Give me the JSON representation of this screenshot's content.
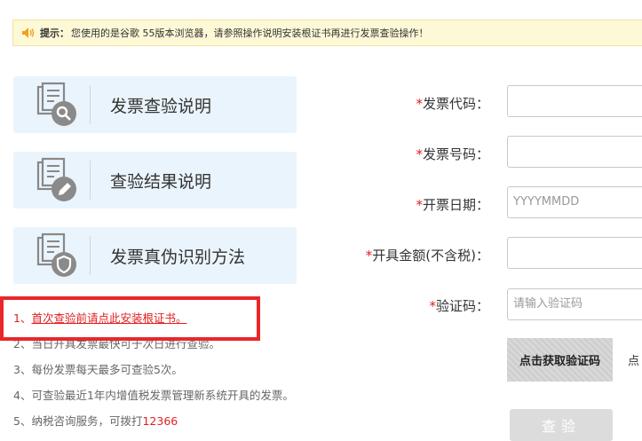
{
  "notice": {
    "label": "提示：",
    "text": "您使用的是谷歌 55版本浏览器，请参照操作说明安装根证书再进行发票查验操作！"
  },
  "cards": [
    {
      "label": "发票查验说明",
      "icon": "document-search-icon"
    },
    {
      "label": "查验结果说明",
      "icon": "document-edit-icon"
    },
    {
      "label": "发票真伪识别方法",
      "icon": "document-shield-icon"
    }
  ],
  "notes": {
    "item1_prefix": "1、",
    "item1_link": "首次查验前请点此安装根证书。",
    "item2": "2、当日开具发票最快可于次日进行查验。",
    "item3": "3、每份发票每天最多可查验5次。",
    "item4": "4、可查验最近1年内增值税发票管理新系统开具的发票。",
    "item5_prefix": "5、纳税咨询服务，可拨打",
    "item5_phone": "12366"
  },
  "form": {
    "required_mark": "*",
    "invoice_code_label": "发票代码：",
    "invoice_number_label": "发票号码：",
    "issue_date_label": "开票日期：",
    "issue_date_placeholder": "YYYYMMDD",
    "amount_label": "开具金额(不含税)：",
    "captcha_label": "验证码：",
    "captcha_placeholder": "请输入验证码",
    "captcha_image_text": "点击获取验证码",
    "captcha_hint": "点",
    "submit_label": "查验"
  },
  "colors": {
    "accent_red": "#e02020",
    "card_bg": "#eaf4fc",
    "notice_bg": "#fdf9d6"
  }
}
